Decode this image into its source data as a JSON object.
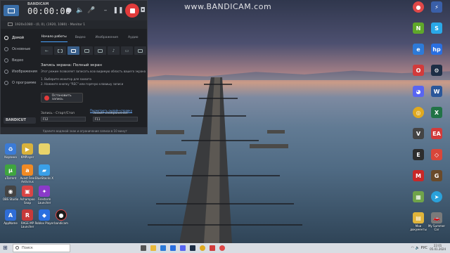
{
  "watermark": "www.BANDICAM.com",
  "desktop": {
    "icons_left": [
      {
        "label": "Корзина",
        "color": "#3b7bd6",
        "icon": "recycle-bin-icon"
      },
      {
        "label": "KMPlayer",
        "color": "#d9b23b",
        "icon": "kmplayer-icon"
      },
      {
        "label": "",
        "color": "#7fbf4a",
        "icon": "folder-icon"
      },
      {
        "label": "uTorrent",
        "color": "#3fa53f",
        "icon": "utorrent-icon"
      },
      {
        "label": "Avast Free Antivirus",
        "color": "#f08a24",
        "icon": "avast-icon"
      },
      {
        "label": "BlueStacks X",
        "color": "#3aa0e8",
        "icon": "bluestacks-icon"
      },
      {
        "label": "OBS Studio",
        "color": "#444",
        "icon": "obs-icon"
      },
      {
        "label": "Ashampoo Snap",
        "color": "#d94545",
        "icon": "snap-icon"
      },
      {
        "label": "Firestorm Launcher",
        "color": "#8a3ac9",
        "icon": "launcher-icon"
      },
      {
        "label": "AppName",
        "color": "#2f6dd6",
        "icon": "app-icon"
      },
      {
        "label": "RAGE MP Launcher",
        "color": "#c73a3a",
        "icon": "rage-icon"
      },
      {
        "label": "Roblox Player",
        "color": "#2a6fe0",
        "icon": "roblox-icon"
      },
      {
        "label": "bandicam",
        "color": "#1b1b1b",
        "icon": "bandicam-icon"
      }
    ],
    "icons_right": [
      {
        "label": "Bandicam",
        "color": "#e04848",
        "icon": "bandicam-icon"
      },
      {
        "label": "Daemon Tools",
        "color": "#3a5fa8",
        "icon": "daemon-icon"
      },
      {
        "label": "NVIDIA",
        "color": "#5fa82a",
        "icon": "nvidia-icon"
      },
      {
        "label": "Skype",
        "color": "#2aa8e8",
        "icon": "skype-icon"
      },
      {
        "label": "Microsoft Edge",
        "color": "#2d7ad8",
        "icon": "edge-icon"
      },
      {
        "label": "HP",
        "color": "#2a6fe0",
        "icon": "hp-icon"
      },
      {
        "label": "Opera",
        "color": "#d23b3b",
        "icon": "opera-icon"
      },
      {
        "label": "Steam",
        "color": "#1d2e45",
        "icon": "steam-icon"
      },
      {
        "label": "Discord",
        "color": "#5865f2",
        "icon": "discord-icon"
      },
      {
        "label": "Word",
        "color": "#2b579a",
        "icon": "word-icon"
      },
      {
        "label": "Chrome",
        "color": "#e0a920",
        "icon": "chrome-icon"
      },
      {
        "label": "Excel",
        "color": "#217346",
        "icon": "excel-icon"
      },
      {
        "label": "Grand Theft Auto V",
        "color": "#444",
        "icon": "gta-icon"
      },
      {
        "label": "EA Games",
        "color": "#d23b3b",
        "icon": "ea-icon"
      },
      {
        "label": "Epic Games",
        "color": "#2d2d2d",
        "icon": "epic-icon"
      },
      {
        "label": "AnyDesk",
        "color": "#d9463a",
        "icon": "anydesk-icon"
      },
      {
        "label": "MSI",
        "color": "#c82828",
        "icon": "msi-icon"
      },
      {
        "label": "Game",
        "color": "#6a4a2a",
        "icon": "game-icon"
      },
      {
        "label": "Minecraft",
        "color": "#6fa34a",
        "icon": "minecraft-icon"
      },
      {
        "label": "Telegram",
        "color": "#2aa1da",
        "icon": "telegram-icon"
      },
      {
        "label": "Chrome",
        "color": "#3aa048",
        "icon": "chrome2-icon"
      },
      {
        "label": "",
        "color": "#888",
        "icon": "app-icon"
      },
      {
        "label": "Мои документы",
        "color": "#e0b43b",
        "icon": "documents-icon"
      },
      {
        "label": "My Summer Car",
        "color": "#7a7a7a",
        "icon": "car-icon"
      }
    ]
  },
  "bandicam": {
    "logo": "BANDICAM",
    "timer": "00:00:00",
    "size": "0 bytes / 0.0GB",
    "status_text": "1920x1080 - (0, 0), (1920, 1080) - Monitor 1",
    "sidebar": [
      "Домой",
      "Основные",
      "Видео",
      "Изображения",
      "О программе"
    ],
    "promo": "BANDICUT",
    "tabs": [
      "Начало работы",
      "Видео",
      "Изображения",
      "Аудио"
    ],
    "mode_title": "Запись экрана: Полный экран",
    "mode_desc": "Этот режим позволяет записать всю видимую область вашего экрана",
    "steps": [
      "1. Выберите монитор для захвата",
      "2. Нажмите кнопку \"REC\" или горячую клавишу записи"
    ],
    "stop_label": "Остановить запись",
    "help_link": "Посмотреть онлайн-справку",
    "hotkey_record_label": "Запись - Старт/Стоп",
    "hotkey_record_value": "F12",
    "hotkey_capture_label": "Захват изображения",
    "hotkey_capture_value": "F11",
    "footer": "Удалите водяной знак и ограничение записи в 10 минут"
  },
  "taskbar": {
    "search_placeholder": "Поиск",
    "time": "22:01",
    "date": "05.01.2024",
    "lang": "РУС"
  },
  "colors": {
    "accent": "#4aa3ff",
    "record": "#e23b3b"
  }
}
